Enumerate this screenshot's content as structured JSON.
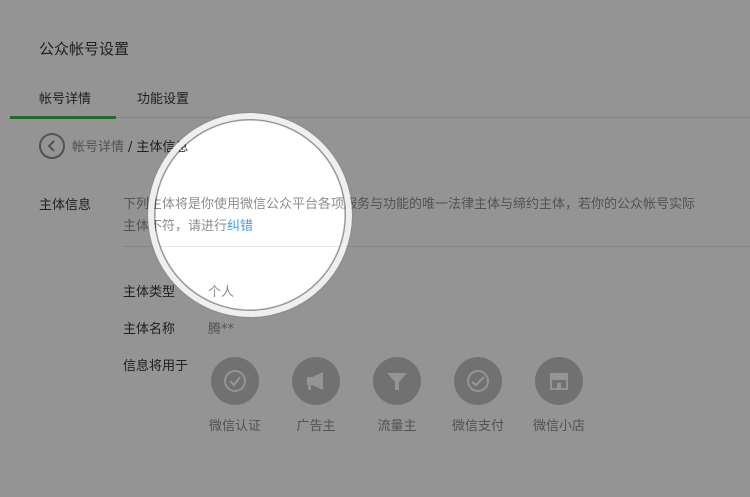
{
  "header": {
    "title": "公众帐号设置"
  },
  "tabs": [
    {
      "label": "帐号详情",
      "active": true
    },
    {
      "label": "功能设置",
      "active": false
    }
  ],
  "breadcrumb": {
    "parent": "帐号详情",
    "separator": "/",
    "current": "主体信息"
  },
  "info": {
    "label": "主体信息",
    "desc_line1": "下列主体将是你使用微信公众平台各项服务与功能的唯一法律主体与缔约主体，若你的公众帐号实际",
    "desc_line2_prefix": "主体不符，请进行",
    "fix_link": "纠错"
  },
  "fields": [
    {
      "label": "主体类型",
      "value": "个人"
    },
    {
      "label": "主体名称",
      "value": "腾**"
    }
  ],
  "usage": {
    "label": "信息将用于",
    "items": [
      {
        "label": "微信认证",
        "icon": "check-icon"
      },
      {
        "label": "广告主",
        "icon": "megaphone-icon"
      },
      {
        "label": "流量主",
        "icon": "funnel-icon"
      },
      {
        "label": "微信支付",
        "icon": "wechat-pay-icon"
      },
      {
        "label": "微信小店",
        "icon": "shop-icon"
      }
    ]
  },
  "colors": {
    "accent": "#44b549",
    "link": "#459ae9",
    "muted": "#8d8d8d",
    "icon_bg": "#c2c2c2"
  }
}
